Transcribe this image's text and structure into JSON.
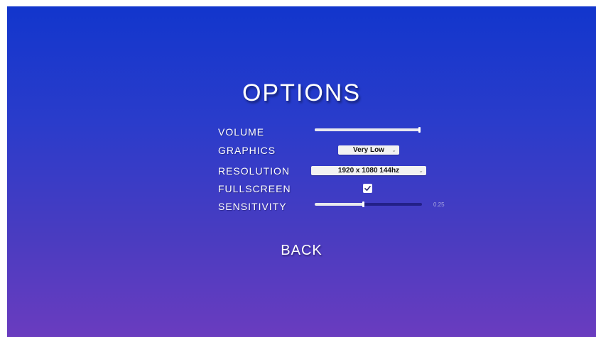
{
  "menu": {
    "title": "OPTIONS",
    "back_label": "BACK"
  },
  "settings": {
    "volume": {
      "label": "VOLUME",
      "level": 1.0
    },
    "graphics": {
      "label": "GRAPHICS",
      "value": "Very Low"
    },
    "resolution": {
      "label": "RESOLUTION",
      "value": "1920 x 1080 144hz"
    },
    "fullscreen": {
      "label": "FULLSCREEN",
      "checked": true
    },
    "sensitivity": {
      "label": "SENSITIVITY",
      "level": 0.25,
      "value_text": "0.25"
    }
  },
  "icons": {
    "checkbox_checked": "check-icon",
    "dropdown": "chevron-down-icon"
  },
  "colors": {
    "background_top": "#1236cc",
    "background_bottom": "#6a3cbf",
    "text": "#ffffff",
    "slider_track_dark": "#232088"
  }
}
